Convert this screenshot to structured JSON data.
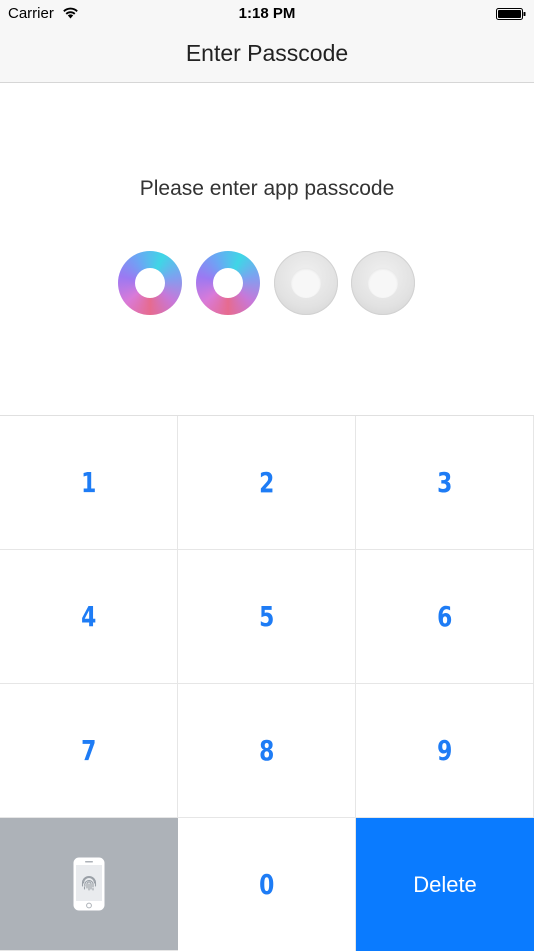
{
  "status_bar": {
    "carrier": "Carrier",
    "time": "1:18 PM"
  },
  "nav": {
    "title": "Enter Passcode"
  },
  "prompt": "Please enter app passcode",
  "passcode": {
    "length": 4,
    "entered": 2
  },
  "keypad": {
    "keys": [
      "1",
      "2",
      "3",
      "4",
      "5",
      "6",
      "7",
      "8",
      "9"
    ],
    "zero": "0",
    "delete_label": "Delete",
    "touch_id_icon": "phone-fingerprint-icon"
  },
  "colors": {
    "key_digit": "#1e7cf5",
    "delete_bg": "#0a7bff",
    "touch_bg": "#adb2b8"
  }
}
